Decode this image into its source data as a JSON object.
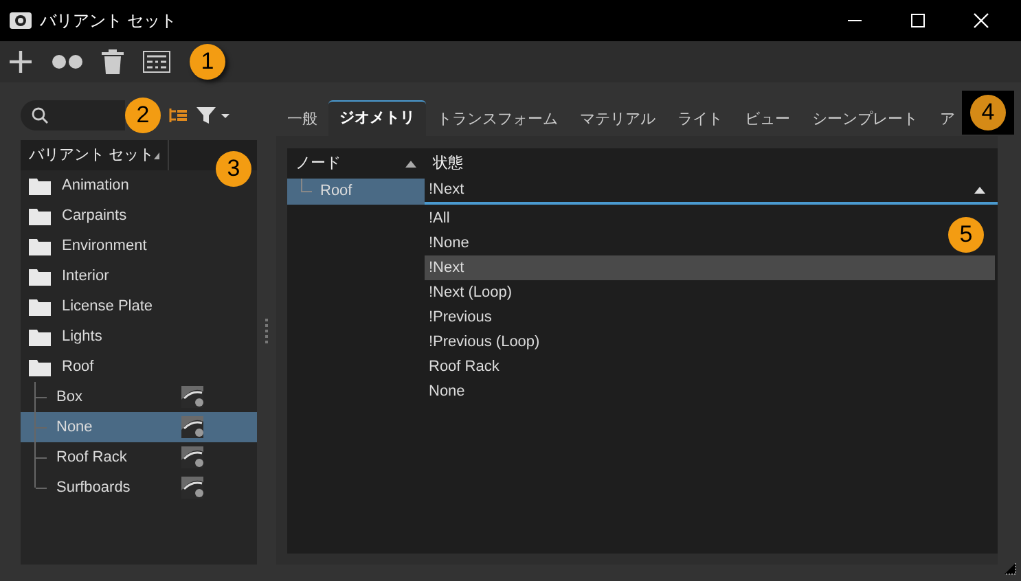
{
  "window": {
    "title": "バリアント セット"
  },
  "toolbar": {
    "callout": "1"
  },
  "callouts": [
    "2",
    "3",
    "4",
    "5"
  ],
  "tree": {
    "header": "バリアント セット",
    "items": [
      {
        "label": "Animation",
        "kind": "folder",
        "selected": false
      },
      {
        "label": "Carpaints",
        "kind": "folder",
        "selected": false
      },
      {
        "label": "Environment",
        "kind": "folder",
        "selected": false
      },
      {
        "label": "Interior",
        "kind": "folder",
        "selected": false
      },
      {
        "label": "License Plate",
        "kind": "folder",
        "selected": false
      },
      {
        "label": "Lights",
        "kind": "folder",
        "selected": false
      },
      {
        "label": "Roof",
        "kind": "folder",
        "selected": false,
        "children": [
          {
            "label": "Box",
            "kind": "variant",
            "selected": false
          },
          {
            "label": "None",
            "kind": "variant",
            "selected": true
          },
          {
            "label": "Roof Rack",
            "kind": "variant",
            "selected": false
          },
          {
            "label": "Surfboards",
            "kind": "variant",
            "selected": false
          }
        ]
      }
    ]
  },
  "tabs": [
    {
      "label": "一般",
      "selected": false
    },
    {
      "label": "ジオメトリ",
      "selected": true
    },
    {
      "label": "トランスフォーム",
      "selected": false
    },
    {
      "label": "マテリアル",
      "selected": false
    },
    {
      "label": "ライト",
      "selected": false
    },
    {
      "label": "ビュー",
      "selected": false
    },
    {
      "label": "シーンプレート",
      "selected": false
    },
    {
      "label": "ア",
      "selected": false
    }
  ],
  "table": {
    "columns": [
      "ノード",
      "状態"
    ],
    "rows": [
      {
        "node": "Roof",
        "state": "!Next",
        "selected": true
      }
    ]
  },
  "dropdown": {
    "options": [
      {
        "label": "!All",
        "selected": false
      },
      {
        "label": "!None",
        "selected": false
      },
      {
        "label": "!Next",
        "selected": true
      },
      {
        "label": "!Next (Loop)",
        "selected": false
      },
      {
        "label": "!Previous",
        "selected": false
      },
      {
        "label": "!Previous (Loop)",
        "selected": false
      },
      {
        "label": "Roof Rack",
        "selected": false
      },
      {
        "label": "None",
        "selected": false
      }
    ]
  }
}
